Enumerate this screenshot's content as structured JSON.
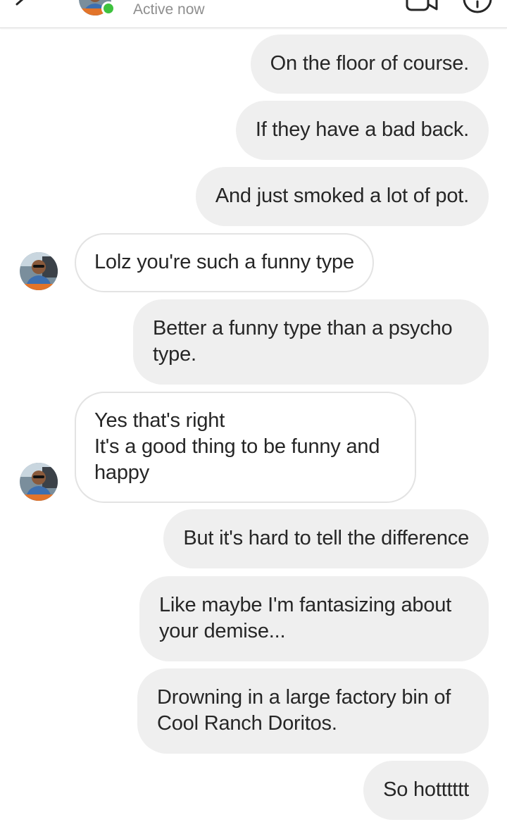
{
  "header": {
    "status": "Active now",
    "online_color": "#3ec23e"
  },
  "contact": {
    "avatar_icon": "avatar-photo-man-in-car"
  },
  "messages": [
    {
      "side": "sent",
      "text": "On the floor of course."
    },
    {
      "side": "sent",
      "text": "If they have a bad back."
    },
    {
      "side": "sent",
      "text": "And just smoked a lot of pot."
    },
    {
      "side": "received",
      "text": "Lolz you're such a funny type"
    },
    {
      "side": "sent",
      "text": "Better a funny type than a psycho\ntype."
    },
    {
      "side": "received",
      "text": "Yes that's right\nIt's a good thing to be funny and\nhappy"
    },
    {
      "side": "sent",
      "text": "But it's hard to tell the difference"
    },
    {
      "side": "sent",
      "text": "Like maybe I'm fantasizing about\nyour demise..."
    },
    {
      "side": "sent",
      "text": "Drowning in a large factory bin of\nCool Ranch Doritos."
    },
    {
      "side": "sent",
      "text": "So hotttttt"
    }
  ]
}
